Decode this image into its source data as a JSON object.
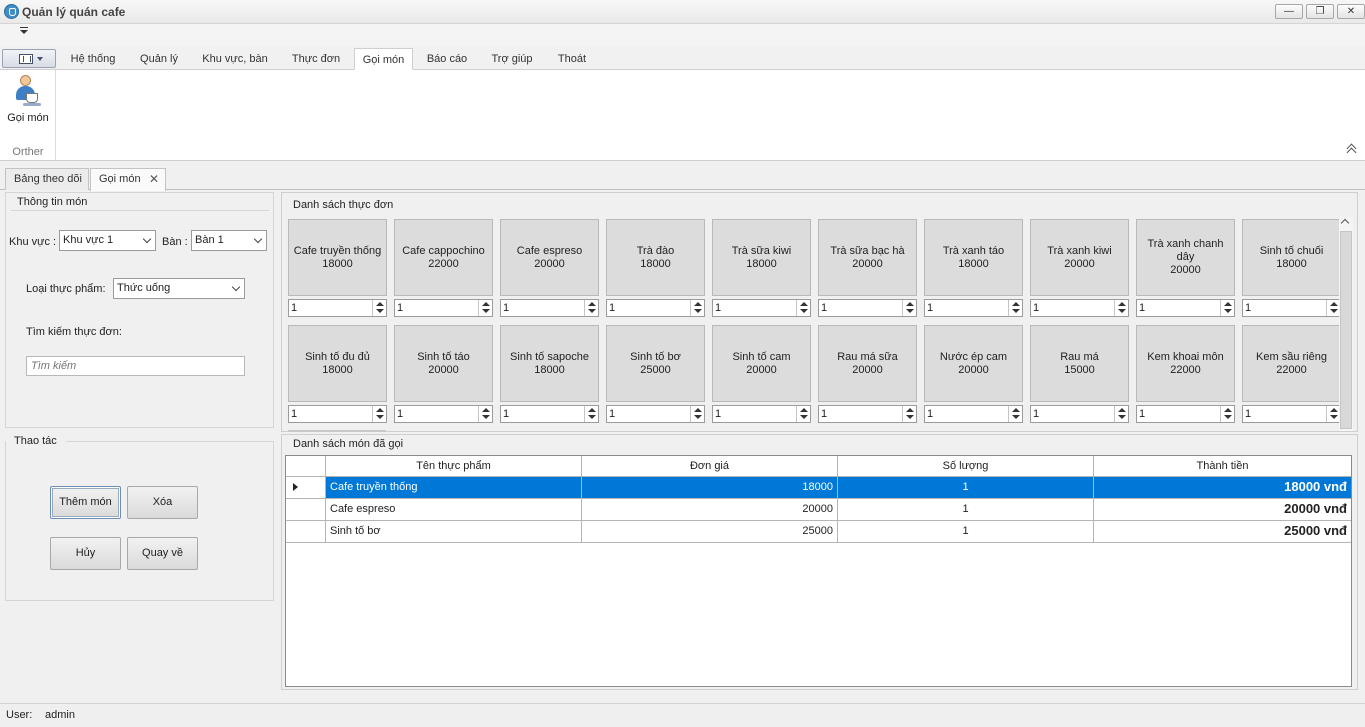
{
  "window": {
    "title": "Quản lý quán cafe",
    "controls": [
      "minimize",
      "restore",
      "close"
    ]
  },
  "ribbon": {
    "tabs": [
      {
        "label": "Hệ thống"
      },
      {
        "label": "Quản lý"
      },
      {
        "label": "Khu vực, bàn"
      },
      {
        "label": "Thực đơn"
      },
      {
        "label": "Gọi món",
        "active": true
      },
      {
        "label": "Báo cáo"
      },
      {
        "label": "Trợ giúp"
      },
      {
        "label": "Thoát"
      }
    ],
    "button_label": "Gọi món",
    "group_caption": "Orther"
  },
  "doc_tabs": [
    {
      "label": "Bảng theo dõi"
    },
    {
      "label": "Gọi món",
      "active": true
    }
  ],
  "info": {
    "group_title": "Thông tin món",
    "area_label": "Khu vực :",
    "area_value": "Khu vực 1",
    "table_label": "Bàn :",
    "table_value": "Bàn 1",
    "type_label": "Loại thực phẩm:",
    "type_value": "Thức uống",
    "search_label": "Tìm kiếm thực đơn:",
    "search_placeholder": "Tìm kiếm"
  },
  "actions": {
    "group_title": "Thao tác",
    "add": "Thêm món",
    "delete": "Xóa",
    "cancel": "Hủy",
    "back": "Quay về"
  },
  "menu": {
    "title": "Danh sách thực đơn",
    "items": [
      {
        "name": "Cafe truyền thống",
        "price": "18000",
        "qty": "1"
      },
      {
        "name": "Cafe cappochino",
        "price": "22000",
        "qty": "1"
      },
      {
        "name": "Cafe espreso",
        "price": "20000",
        "qty": "1"
      },
      {
        "name": "Trà đào",
        "price": "18000",
        "qty": "1"
      },
      {
        "name": "Trà sữa kiwi",
        "price": "18000",
        "qty": "1"
      },
      {
        "name": "Trà sữa bạc hà",
        "price": "20000",
        "qty": "1"
      },
      {
        "name": "Trà xanh táo",
        "price": "18000",
        "qty": "1"
      },
      {
        "name": "Trà xanh kiwi",
        "price": "20000",
        "qty": "1"
      },
      {
        "name": "Trà xanh chanh dây",
        "price": "20000",
        "qty": "1"
      },
      {
        "name": "Sinh tố chuối",
        "price": "18000",
        "qty": "1"
      },
      {
        "name": "Sinh tố đu đủ",
        "price": "18000",
        "qty": "1"
      },
      {
        "name": "Sinh tố táo",
        "price": "20000",
        "qty": "1"
      },
      {
        "name": "Sinh tố sapoche",
        "price": "18000",
        "qty": "1"
      },
      {
        "name": "Sinh tố bơ",
        "price": "25000",
        "qty": "1"
      },
      {
        "name": "Sinh tố cam",
        "price": "20000",
        "qty": "1"
      },
      {
        "name": "Rau má sữa",
        "price": "20000",
        "qty": "1"
      },
      {
        "name": "Nước ép cam",
        "price": "20000",
        "qty": "1"
      },
      {
        "name": "Rau má",
        "price": "15000",
        "qty": "1"
      },
      {
        "name": "Kem khoai môn",
        "price": "22000",
        "qty": "1"
      },
      {
        "name": "Kem sầu riêng",
        "price": "22000",
        "qty": "1"
      }
    ]
  },
  "orders": {
    "title": "Danh sách món đã gọi",
    "columns": [
      "Tên thực phẩm",
      "Đơn giá",
      "Số lượng",
      "Thành tiền"
    ],
    "rows": [
      {
        "name": "Cafe truyền thống",
        "price": "18000",
        "qty": "1",
        "total": "18000 vnđ",
        "selected": true
      },
      {
        "name": "Cafe espreso",
        "price": "20000",
        "qty": "1",
        "total": "20000 vnđ"
      },
      {
        "name": "Sinh tố bơ",
        "price": "25000",
        "qty": "1",
        "total": "25000 vnđ"
      }
    ]
  },
  "status": {
    "user_label": "User:",
    "user_value": "admin"
  },
  "colors": {
    "selection": "#0078d7",
    "tile": "#dcdcdc"
  }
}
